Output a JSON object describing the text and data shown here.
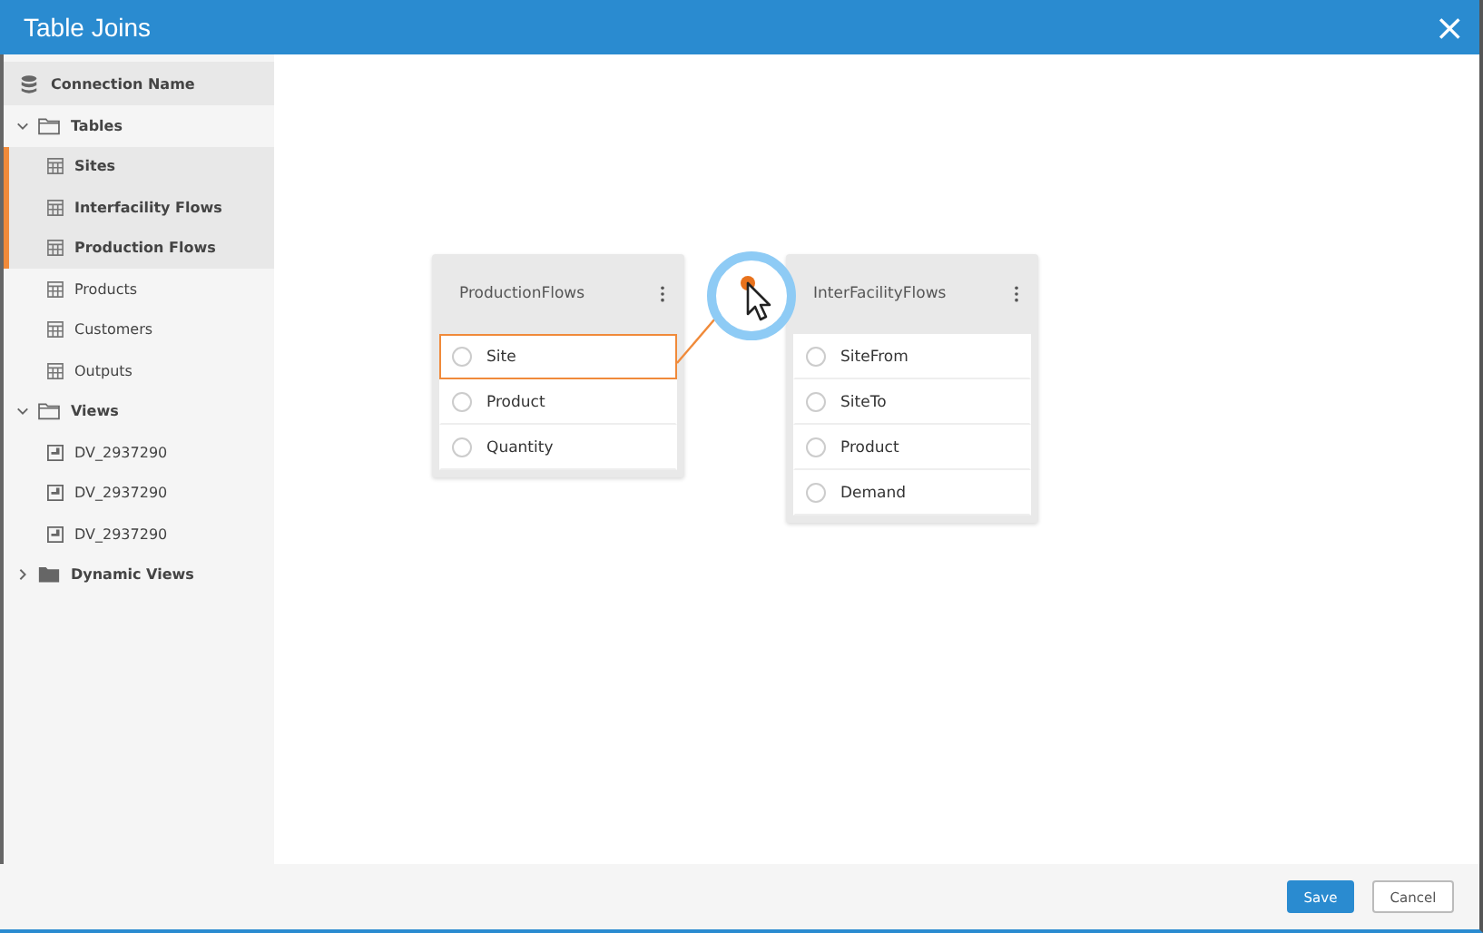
{
  "window": {
    "title": "Table Joins",
    "close": "×"
  },
  "sidebar": {
    "items": [
      {
        "label": "Connection Name",
        "kind": "connection"
      },
      {
        "label": "Tables",
        "kind": "folder",
        "expanded": true,
        "selected": false,
        "children": [
          {
            "label": "Sites",
            "kind": "table",
            "selected": true
          },
          {
            "label": "Interfacility Flows",
            "kind": "table",
            "selected": true
          },
          {
            "label": "Production Flows",
            "kind": "table",
            "selected": true
          },
          {
            "label": "Products",
            "kind": "table",
            "selected": false
          },
          {
            "label": "Customers",
            "kind": "table",
            "selected": false
          },
          {
            "label": "Outputs",
            "kind": "table",
            "selected": false
          }
        ]
      },
      {
        "label": "Views",
        "kind": "folder",
        "expanded": true,
        "selected": false,
        "children": [
          {
            "label": "DV_2937290",
            "kind": "view",
            "selected": false
          },
          {
            "label": "DV_2937290",
            "kind": "view",
            "selected": false
          },
          {
            "label": "DV_2937290",
            "kind": "view",
            "selected": false
          }
        ]
      },
      {
        "label": "Dynamic Views",
        "kind": "folder-filled",
        "expanded": false,
        "selected": false
      }
    ]
  },
  "tables": [
    {
      "name": "ProductionFlows",
      "fields": [
        {
          "name": "Site",
          "selected": true
        },
        {
          "name": "Product",
          "selected": false
        },
        {
          "name": "Quantity",
          "selected": false
        }
      ]
    },
    {
      "name": "InterFacilityFlows",
      "fields": [
        {
          "name": "SiteFrom",
          "selected": false
        },
        {
          "name": "SiteTo",
          "selected": false
        },
        {
          "name": "Product",
          "selected": false
        },
        {
          "name": "Demand",
          "selected": false
        }
      ]
    }
  ],
  "buttons": [
    {
      "label": "Save",
      "kind": "primary"
    },
    {
      "label": "Cancel",
      "kind": "secondary"
    }
  ]
}
